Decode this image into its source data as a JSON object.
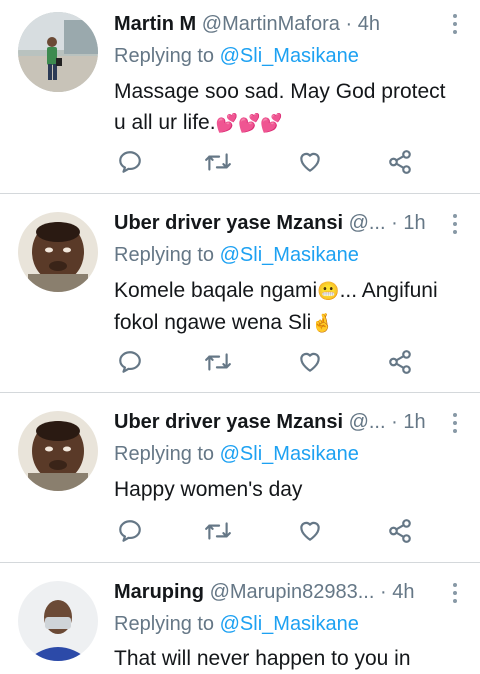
{
  "tweets": [
    {
      "name": "Martin M",
      "handle": "@MartinMafora",
      "dot": "·",
      "time": "4h",
      "replying_prefix": "Replying to",
      "replying_to": "@Sli_Masikane",
      "line1": "Massage soo sad. May God protect",
      "line2": "u all ur life.",
      "line2_emoji": "💕💕💕"
    },
    {
      "name": "Uber driver yase Mzansi",
      "handle": "@...",
      "dot": "·",
      "time": "1h",
      "replying_prefix": "Replying to",
      "replying_to": "@Sli_Masikane",
      "line1": "Komele baqale ngami",
      "line1_emoji": "😬",
      "line1_rest": "... Angifuni",
      "line2": "fokol ngawe wena Sli",
      "line2_emoji": "🤞"
    },
    {
      "name": "Uber driver yase Mzansi",
      "handle": "@...",
      "dot": "·",
      "time": "1h",
      "replying_prefix": "Replying to",
      "replying_to": "@Sli_Masikane",
      "line1": "Happy women's day"
    },
    {
      "name": "Maruping",
      "handle": "@Marupin82983...",
      "dot": "·",
      "time": "4h",
      "replying_prefix": "Replying to",
      "replying_to": "@Sli_Masikane",
      "line1": "That will never happen to you in"
    }
  ],
  "icons": {
    "reply": "reply-icon",
    "retweet": "retweet-icon",
    "like": "heart-icon",
    "share": "share-icon",
    "more": "more-vertical-icon"
  },
  "colors": {
    "link": "#1da1f2",
    "muted": "#657786",
    "icon": "#657786",
    "divider": "#d4d8db"
  }
}
